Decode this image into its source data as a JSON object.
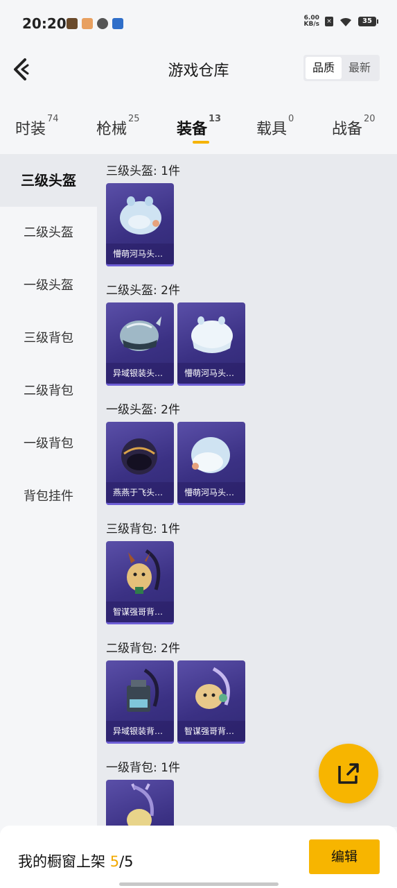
{
  "status_bar": {
    "time": "20:20",
    "net_speed": "6.00",
    "net_unit": "KB/s",
    "battery": "35"
  },
  "header": {
    "title": "游戏仓库",
    "sort_options": [
      "品质",
      "最新"
    ]
  },
  "tabs": [
    {
      "label": "时装",
      "count": "74"
    },
    {
      "label": "枪械",
      "count": "25"
    },
    {
      "label": "装备",
      "count": "13"
    },
    {
      "label": "载具",
      "count": "0"
    },
    {
      "label": "战备",
      "count": "20"
    }
  ],
  "sidebar": [
    "三级头盔",
    "二级头盔",
    "一级头盔",
    "三级背包",
    "二级背包",
    "一级背包",
    "背包挂件"
  ],
  "sections": [
    {
      "title": "三级头盔: 1件",
      "items": [
        {
          "name": "懵萌河马头…",
          "icon": "hippo-helmet"
        }
      ]
    },
    {
      "title": "二级头盔: 2件",
      "items": [
        {
          "name": "异域银装头…",
          "icon": "silver-helmet"
        },
        {
          "name": "懵萌河马头…",
          "icon": "hippo-helmet"
        }
      ]
    },
    {
      "title": "一级头盔: 2件",
      "items": [
        {
          "name": "燕燕于飞头…",
          "icon": "dark-helmet"
        },
        {
          "name": "懵萌河马头…",
          "icon": "white-helmet"
        }
      ]
    },
    {
      "title": "三级背包: 1件",
      "items": [
        {
          "name": "智谋强哥背…",
          "icon": "plush-backpack"
        }
      ]
    },
    {
      "title": "二级背包: 2件",
      "items": [
        {
          "name": "异域银装背…",
          "icon": "silver-backpack"
        },
        {
          "name": "智谋强哥背…",
          "icon": "plush-backpack"
        }
      ]
    },
    {
      "title": "一级背包: 1件",
      "items": [
        {
          "name": "",
          "icon": "plush-backpack"
        }
      ]
    }
  ],
  "bottom_bar": {
    "label": "我的橱窗上架",
    "current": "5",
    "separator": "/",
    "total": "5",
    "edit_label": "编辑"
  },
  "colors": {
    "accent": "#f7b500",
    "card": "#3b3184"
  }
}
